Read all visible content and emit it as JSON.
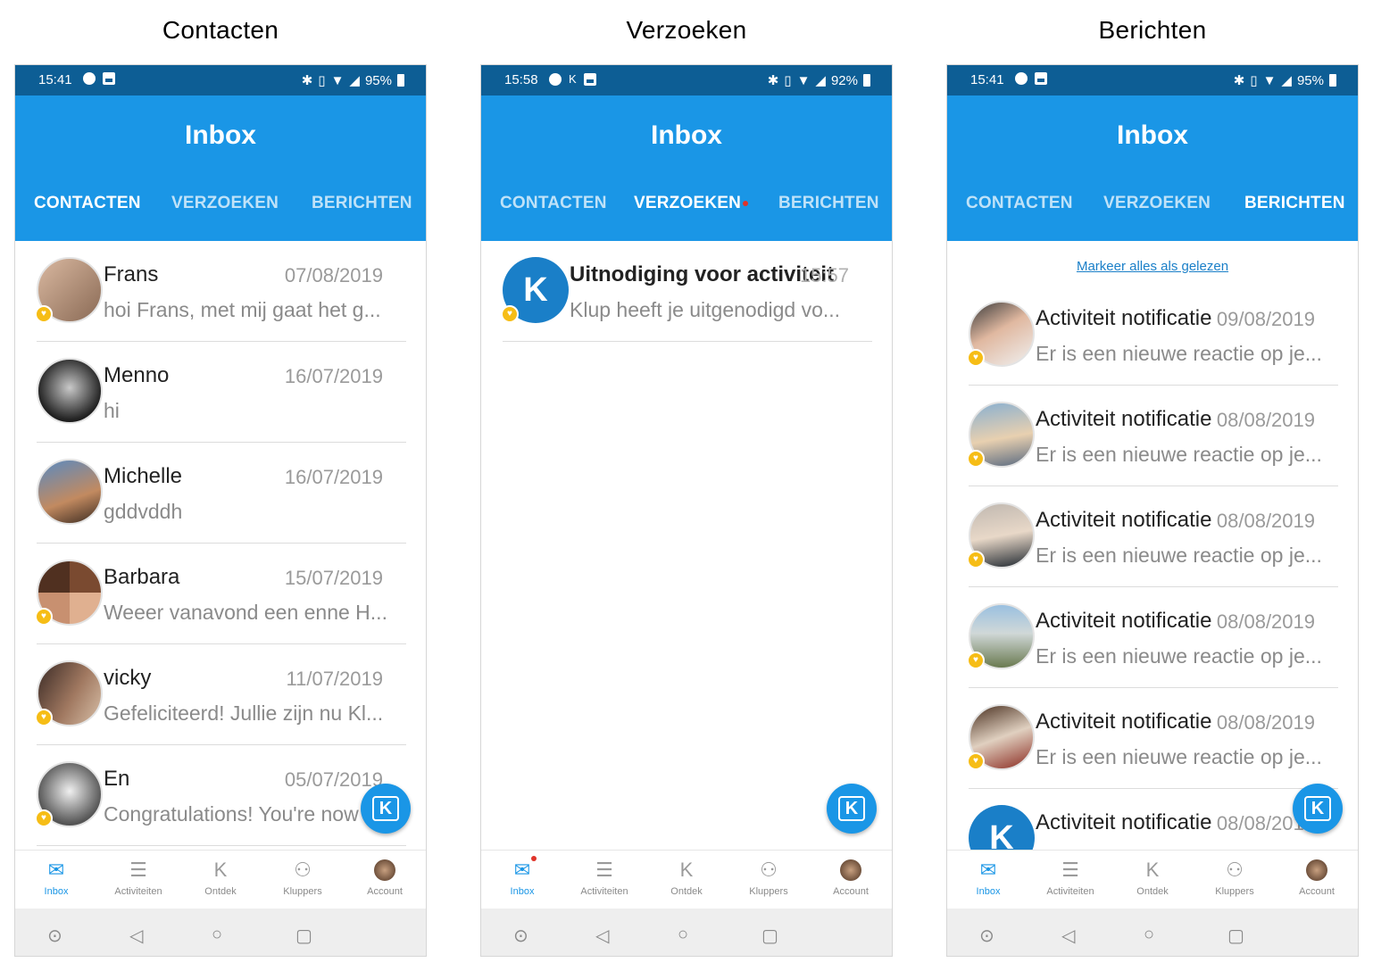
{
  "panels": [
    {
      "heading": "Contacten",
      "status": {
        "time": "15:41",
        "battery": "95%"
      },
      "app_title": "Inbox",
      "tabs": [
        {
          "label": "CONTACTEN",
          "active": true
        },
        {
          "label": "VERZOEKEN",
          "active": false
        },
        {
          "label": "BERICHTEN",
          "active": false
        }
      ],
      "rows": [
        {
          "name": "Frans",
          "date": "07/08/2019",
          "preview": "hoi Frans, met mij gaat het g..."
        },
        {
          "name": "Menno",
          "date": "16/07/2019",
          "preview": "hi"
        },
        {
          "name": "Michelle",
          "date": "16/07/2019",
          "preview": "gddvddh"
        },
        {
          "name": "Barbara",
          "date": "15/07/2019",
          "preview": "Weeer vanavond een enne H..."
        },
        {
          "name": "vicky",
          "date": "11/07/2019",
          "preview": "Gefeliciteerd! Jullie zijn nu Kl..."
        },
        {
          "name": "En",
          "date": "05/07/2019",
          "preview": "Congratulations! You're now"
        }
      ]
    },
    {
      "heading": "Verzoeken",
      "status": {
        "time": "15:58",
        "battery": "92%"
      },
      "app_title": "Inbox",
      "tabs": [
        {
          "label": "CONTACTEN",
          "active": false
        },
        {
          "label": "VERZOEKEN",
          "active": true
        },
        {
          "label": "BERICHTEN",
          "active": false
        }
      ],
      "rows": [
        {
          "name": "Uitnodiging voor activiteit",
          "date": "15:57",
          "preview": "Klup heeft je uitgenodigd vo..."
        }
      ]
    },
    {
      "heading": "Berichten",
      "status": {
        "time": "15:41",
        "battery": "95%"
      },
      "app_title": "Inbox",
      "mark_all_read": "Markeer alles als gelezen",
      "tabs": [
        {
          "label": "CONTACTEN",
          "active": false
        },
        {
          "label": "VERZOEKEN",
          "active": false
        },
        {
          "label": "BERICHTEN",
          "active": true
        }
      ],
      "rows": [
        {
          "name": "Activiteit notificatie",
          "date": "09/08/2019",
          "preview": "Er is een nieuwe reactie op je..."
        },
        {
          "name": "Activiteit notificatie",
          "date": "08/08/2019",
          "preview": "Er is een nieuwe reactie op je..."
        },
        {
          "name": "Activiteit notificatie",
          "date": "08/08/2019",
          "preview": "Er is een nieuwe reactie op je..."
        },
        {
          "name": "Activiteit notificatie",
          "date": "08/08/2019",
          "preview": "Er is een nieuwe reactie op je..."
        },
        {
          "name": "Activiteit notificatie",
          "date": "08/08/2019",
          "preview": "Er is een nieuwe reactie op je..."
        },
        {
          "name": "Activiteit notificatie",
          "date": "08/08/2019",
          "preview": ""
        }
      ]
    }
  ],
  "bottom_nav": [
    "Inbox",
    "Activiteiten",
    "Ontdek",
    "Kluppers",
    "Account"
  ],
  "colors": {
    "brand": "#1a96e6",
    "statusbar": "#0d5e95",
    "badge": "#f6bd16",
    "unread_dot": "#e0342a"
  }
}
